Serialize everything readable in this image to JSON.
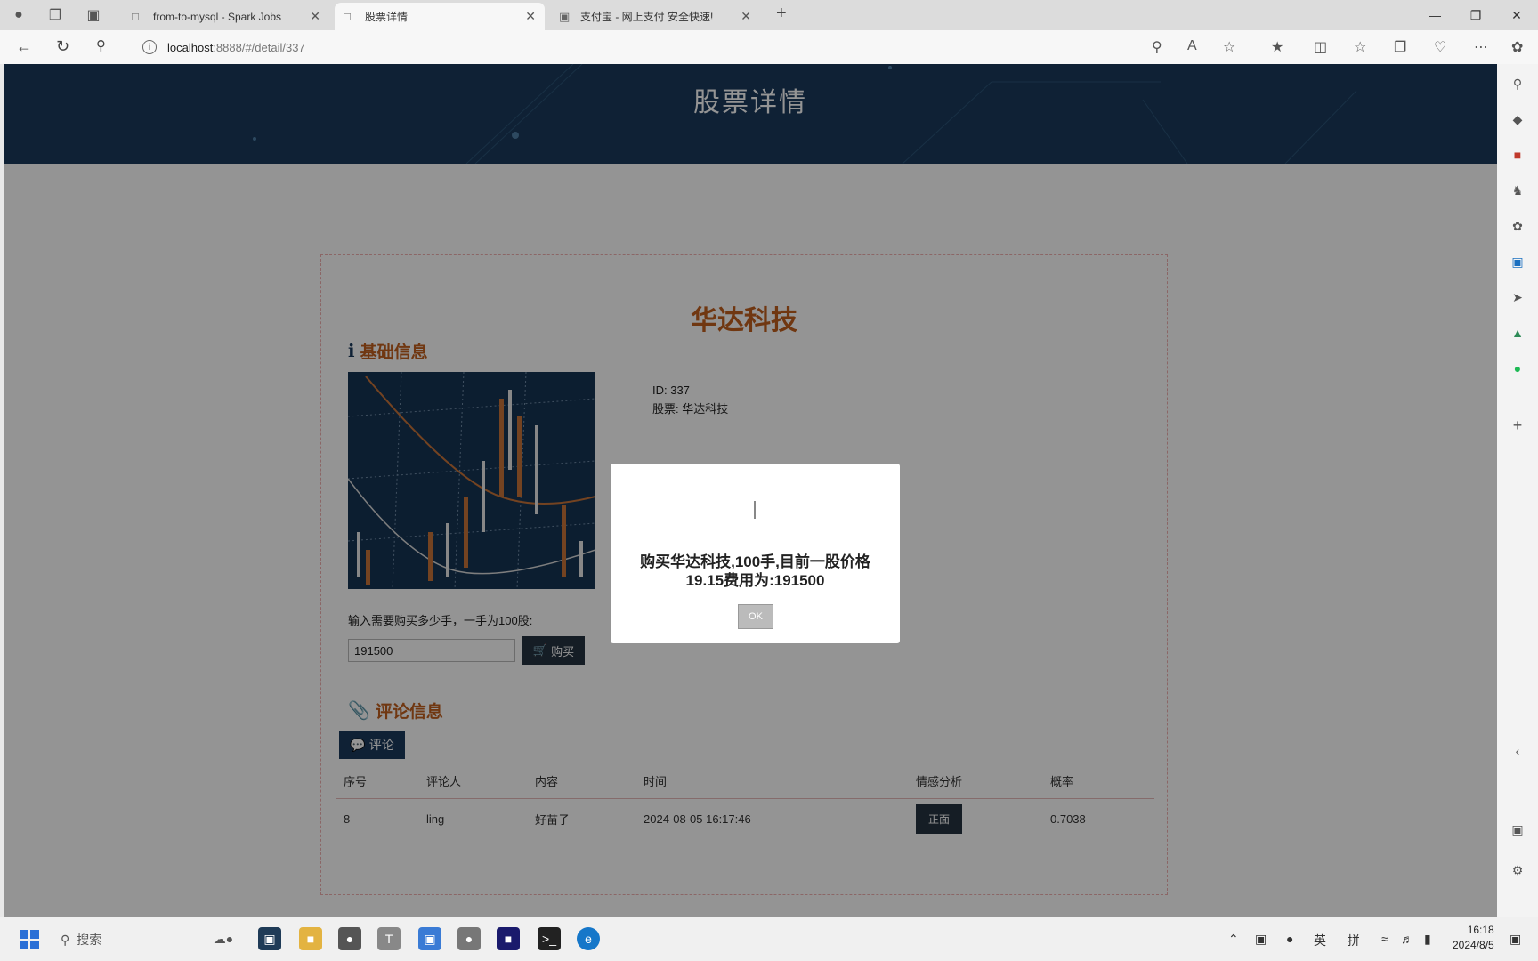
{
  "browser": {
    "tabs": [
      {
        "title": "from-to-mysql - Spark Jobs",
        "active": false
      },
      {
        "title": "股票详情",
        "active": true
      },
      {
        "title": "支付宝 - 网上支付 安全快速!",
        "active": false
      }
    ],
    "url_host": "localhost",
    "url_rest": ":8888/#/detail/337"
  },
  "page": {
    "header_title": "股票详情",
    "stock_name": "华达科技",
    "basic_info_title": "基础信息",
    "info_id": "ID: 337",
    "info_stock": "股票: 华达科技",
    "buy_hint": "输入需要购买多少手，一手为100股:",
    "buy_input_value": "191500",
    "buy_button": "购买",
    "comments_title": "评论信息",
    "comment_button": "评论",
    "table_headers": [
      "序号",
      "评论人",
      "内容",
      "时间",
      "情感分析",
      "概率"
    ],
    "rows": [
      {
        "id": "8",
        "user": "ling",
        "content": "好苗子",
        "time": "2024-08-05 16:17:46",
        "sentiment": "正面",
        "prob": "0.7038"
      }
    ]
  },
  "modal": {
    "message": "购买华达科技,100手,目前一股价格19.15费用为:191500",
    "ok_label": "OK"
  },
  "taskbar": {
    "search_label": "搜索",
    "ime_lang": "英",
    "ime_mode": "拼",
    "time": "16:18",
    "date": "2024/8/5"
  },
  "colors": {
    "header_bg": "#1a3a5c",
    "accent": "#c15f1e",
    "dark_button": "#253341"
  }
}
